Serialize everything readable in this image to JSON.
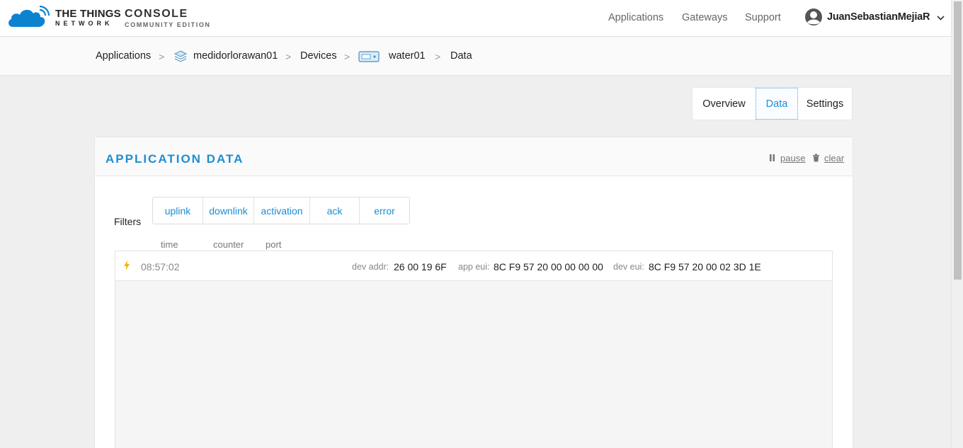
{
  "brand": {
    "logo_main": "THE THINGS",
    "logo_sub": "NETWORK",
    "console_main": "CONSOLE",
    "console_sub": "COMMUNITY EDITION"
  },
  "nav": {
    "applications": "Applications",
    "gateways": "Gateways",
    "support": "Support",
    "user": "JuanSebastianMejiaR"
  },
  "breadcrumb": {
    "applications": "Applications",
    "application": "medidorlorawan01",
    "devices": "Devices",
    "device": "water01",
    "current": "Data",
    "separator": ">"
  },
  "tabs": {
    "overview": "Overview",
    "data": "Data",
    "settings": "Settings",
    "active": "Data"
  },
  "panel": {
    "title": "APPLICATION DATA",
    "pause": "pause",
    "clear": "clear"
  },
  "filters": {
    "label": "Filters",
    "items": [
      "uplink",
      "downlink",
      "activation",
      "ack",
      "error"
    ]
  },
  "columns": {
    "time": "time",
    "counter": "counter",
    "port": "port"
  },
  "rows": [
    {
      "type": "activation",
      "time": "08:57:02",
      "dev_addr_label": "dev addr:",
      "dev_addr": "26 00 19 6F",
      "app_eui_label": "app eui:",
      "app_eui": "8C F9 57 20 00 00 00 00",
      "dev_eui_label": "dev eui:",
      "dev_eui": "8C F9 57 20 00 02 3D 1E"
    }
  ],
  "colors": {
    "accent": "#1d8dd4",
    "bolt": "#f5b400",
    "logo": "#0d83d0"
  },
  "icons": {
    "logo": "cloud-logo-icon",
    "user": "user-avatar-icon",
    "chevron": "chevron-down-icon",
    "application": "stack-icon",
    "device": "device-icon",
    "pause": "pause-icon",
    "clear": "trash-icon",
    "event": "lightning-icon"
  }
}
